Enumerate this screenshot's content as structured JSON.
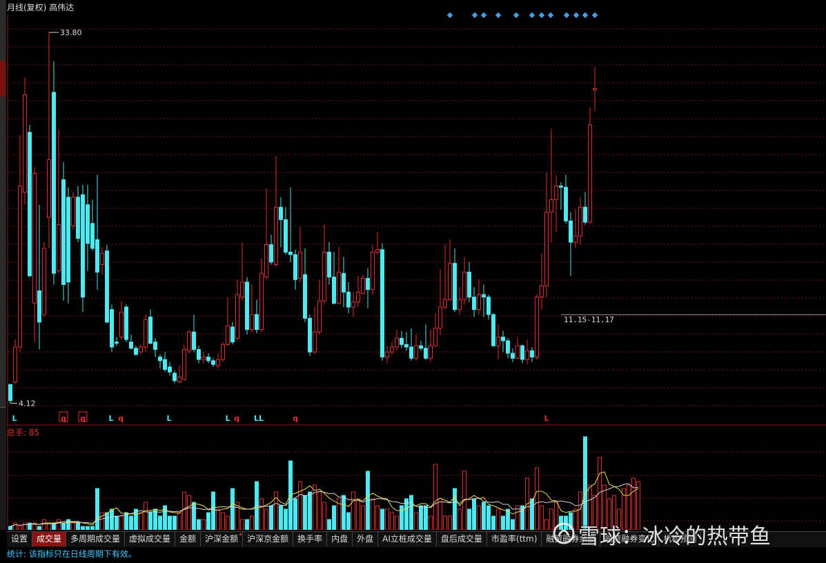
{
  "header": {
    "title": "月线(复权) 高伟达"
  },
  "volume_header": {
    "label": "总手: 85"
  },
  "colors": {
    "up": "#e03030",
    "down": "#4ee8f0",
    "ma_white": "#d8d8d8",
    "ma_yellow": "#f0e040",
    "grid": "#7a1a1a",
    "marker_blue": "#3ea0f0"
  },
  "chart_data": [
    {
      "type": "candlestick",
      "title": "月线(复权) 高伟达",
      "annotations": {
        "high": "33.80",
        "low": "4.12",
        "range_label": "11.15-11.17"
      },
      "ylim": [
        4.12,
        33.8
      ],
      "signals": [
        "L",
        "q",
        "q",
        "L",
        "q",
        "L",
        "L",
        "q",
        "LL",
        "q",
        "L"
      ],
      "candles": [
        [
          5.6,
          4.3,
          5.6,
          4.1
        ],
        [
          5.8,
          8.6,
          9.2,
          5.6
        ],
        [
          8.6,
          21.5,
          25.6,
          8.2
        ],
        [
          21.0,
          28.8,
          30.2,
          20.0
        ],
        [
          25.8,
          14.3,
          26.4,
          14.2
        ],
        [
          12.1,
          22.5,
          23.0,
          9.0
        ],
        [
          13.1,
          10.6,
          20.0,
          8.4
        ],
        [
          11.2,
          16.5,
          17.0,
          11.0
        ],
        [
          19.0,
          23.6,
          33.8,
          16.5
        ],
        [
          29.0,
          14.5,
          31.5,
          13.6
        ],
        [
          14.7,
          18.4,
          26.0,
          14.5
        ],
        [
          22.0,
          13.6,
          23.4,
          12.3
        ],
        [
          20.6,
          13.8,
          21.4,
          12.1
        ],
        [
          18.3,
          20.6,
          21.0,
          18.0
        ],
        [
          20.6,
          17.3,
          21.5,
          17.0
        ],
        [
          20.8,
          12.6,
          21.6,
          11.4
        ],
        [
          20.0,
          16.9,
          21.6,
          14.7
        ],
        [
          18.5,
          16.5,
          20.4,
          16.3
        ],
        [
          17.2,
          14.6,
          22.4,
          13.2
        ],
        [
          15.2,
          16.1,
          16.6,
          14.4
        ],
        [
          16.3,
          10.6,
          16.8,
          10.5
        ],
        [
          11.6,
          8.6,
          12.0,
          8.2
        ],
        [
          9.0,
          8.9,
          9.4,
          8.7
        ],
        [
          9.4,
          11.4,
          12.3,
          9.2
        ],
        [
          11.8,
          9.2,
          12.0,
          9.0
        ],
        [
          9.0,
          8.5,
          9.6,
          8.4
        ],
        [
          8.5,
          8.0,
          8.7,
          7.9
        ],
        [
          8.2,
          8.6,
          8.8,
          8.0
        ],
        [
          8.6,
          10.8,
          11.2,
          8.2
        ],
        [
          11.0,
          8.9,
          11.6,
          8.8
        ],
        [
          9.0,
          8.4,
          9.3,
          7.8
        ],
        [
          7.8,
          7.5,
          8.0,
          6.9
        ],
        [
          7.6,
          6.8,
          8.2,
          6.6
        ],
        [
          7.0,
          6.6,
          7.4,
          6.3
        ],
        [
          6.5,
          5.9,
          6.7,
          5.7
        ],
        [
          5.8,
          6.2,
          7.1,
          5.7
        ],
        [
          6.0,
          8.4,
          8.8,
          5.9
        ],
        [
          8.3,
          9.8,
          10.0,
          8.1
        ],
        [
          9.8,
          8.4,
          11.2,
          8.2
        ],
        [
          8.4,
          7.6,
          8.7,
          7.3
        ],
        [
          7.6,
          7.8,
          8.2,
          7.3
        ],
        [
          7.8,
          7.5,
          8.1,
          7.3
        ],
        [
          7.5,
          7.2,
          7.7,
          7.0
        ],
        [
          7.1,
          7.6,
          8.1,
          6.9
        ],
        [
          7.6,
          8.8,
          9.0,
          7.4
        ],
        [
          8.8,
          10.3,
          12.6,
          8.7
        ],
        [
          10.2,
          9.0,
          10.6,
          8.8
        ],
        [
          9.3,
          12.8,
          14.0,
          9.1
        ],
        [
          12.6,
          13.8,
          17.0,
          12.3
        ],
        [
          13.8,
          10.0,
          14.2,
          9.6
        ],
        [
          10.0,
          11.2,
          13.6,
          9.8
        ],
        [
          11.2,
          10.0,
          12.4,
          9.7
        ],
        [
          10.0,
          14.5,
          15.7,
          9.8
        ],
        [
          14.2,
          16.8,
          21.3,
          14.0
        ],
        [
          16.8,
          15.4,
          17.6,
          15.2
        ],
        [
          15.2,
          19.8,
          23.9,
          15.0
        ],
        [
          19.8,
          18.8,
          20.6,
          16.6
        ],
        [
          18.8,
          16.2,
          19.8,
          16.0
        ],
        [
          16.2,
          16.0,
          21.4,
          15.4
        ],
        [
          16.0,
          14.0,
          16.4,
          13.2
        ],
        [
          14.1,
          16.2,
          18.2,
          13.8
        ],
        [
          14.4,
          10.9,
          16.5,
          10.6
        ],
        [
          10.9,
          8.2,
          11.2,
          7.9
        ],
        [
          8.2,
          9.8,
          11.8,
          8.0
        ],
        [
          9.8,
          12.3,
          14.0,
          9.6
        ],
        [
          12.3,
          16.2,
          18.4,
          12.0
        ],
        [
          16.2,
          14.2,
          17.0,
          13.6
        ],
        [
          14.2,
          12.1,
          16.2,
          12.0
        ],
        [
          12.1,
          14.6,
          16.6,
          12.0
        ],
        [
          14.5,
          13.0,
          15.8,
          11.8
        ],
        [
          13.0,
          11.8,
          13.8,
          11.3
        ],
        [
          11.8,
          12.2,
          13.0,
          11.0
        ],
        [
          12.2,
          13.0,
          14.3,
          11.8
        ],
        [
          12.9,
          14.1,
          14.4,
          12.8
        ],
        [
          14.1,
          13.2,
          14.9,
          11.7
        ],
        [
          13.2,
          16.2,
          16.8,
          12.8
        ],
        [
          16.2,
          16.4,
          17.8,
          16.0
        ],
        [
          16.4,
          7.8,
          16.9,
          7.5
        ],
        [
          7.8,
          8.2,
          8.7,
          7.3
        ],
        [
          8.2,
          8.6,
          9.0,
          8.0
        ],
        [
          8.6,
          9.3,
          10.0,
          8.3
        ],
        [
          9.3,
          8.8,
          9.9,
          8.5
        ],
        [
          8.8,
          8.6,
          9.8,
          8.3
        ],
        [
          8.6,
          7.7,
          10.1,
          7.5
        ],
        [
          7.7,
          8.7,
          9.6,
          7.5
        ],
        [
          8.7,
          8.5,
          9.1,
          8.3
        ],
        [
          8.5,
          7.7,
          10.4,
          7.6
        ],
        [
          7.7,
          8.7,
          10.0,
          7.4
        ],
        [
          8.7,
          10.1,
          11.3,
          8.6
        ],
        [
          10.1,
          11.8,
          14.8,
          9.6
        ],
        [
          11.8,
          12.4,
          16.8,
          11.6
        ],
        [
          12.4,
          15.3,
          17.2,
          12.3
        ],
        [
          15.3,
          11.6,
          16.5,
          11.4
        ],
        [
          11.6,
          12.4,
          13.4,
          11.2
        ],
        [
          12.4,
          14.6,
          15.8,
          12.0
        ],
        [
          14.6,
          12.6,
          15.4,
          12.2
        ],
        [
          12.6,
          11.6,
          13.4,
          11.0
        ],
        [
          11.6,
          12.8,
          14.0,
          11.2
        ],
        [
          12.8,
          12.6,
          13.6,
          11.0
        ],
        [
          12.6,
          11.2,
          12.8,
          10.8
        ],
        [
          11.2,
          8.7,
          11.3,
          8.6
        ],
        [
          8.7,
          9.4,
          10.4,
          7.6
        ],
        [
          9.4,
          9.1,
          9.9,
          8.2
        ],
        [
          9.1,
          8.1,
          9.3,
          7.7
        ],
        [
          8.1,
          7.7,
          8.5,
          7.4
        ],
        [
          7.7,
          8.7,
          9.4,
          7.6
        ],
        [
          8.7,
          7.6,
          8.8,
          7.3
        ],
        [
          7.6,
          8.3,
          9.2,
          7.2
        ],
        [
          8.3,
          7.8,
          8.6,
          7.4
        ],
        [
          7.8,
          12.6,
          12.8,
          7.6
        ],
        [
          12.6,
          13.5,
          16.1,
          11.6
        ],
        [
          13.5,
          19.4,
          22.6,
          12.6
        ],
        [
          19.4,
          20.4,
          26.1,
          17.0
        ],
        [
          20.4,
          21.5,
          22.4,
          17.8
        ],
        [
          21.5,
          21.4,
          21.8,
          19.6
        ],
        [
          21.4,
          18.7,
          22.4,
          18.5
        ],
        [
          18.7,
          17.0,
          19.4,
          14.3
        ],
        [
          17.0,
          17.5,
          19.6,
          16.5
        ],
        [
          17.5,
          19.8,
          20.6,
          16.8
        ],
        [
          19.8,
          18.6,
          21.0,
          18.4
        ],
        [
          18.6,
          26.4,
          27.8,
          18.4
        ],
        [
          29.2,
          29.3,
          31.0,
          27.5
        ]
      ]
    },
    {
      "type": "bar",
      "title": "总手: 85",
      "values": [
        1,
        2,
        1,
        2,
        2,
        2,
        1,
        3,
        2,
        2,
        3,
        2,
        3,
        2,
        2,
        1,
        1,
        1,
        12,
        5,
        5,
        6,
        4,
        4,
        5,
        4,
        6,
        5,
        8,
        5,
        6,
        4,
        7,
        4,
        4,
        5,
        11,
        10,
        8,
        3,
        3,
        5,
        11,
        6,
        5,
        4,
        12,
        8,
        3,
        3,
        4,
        14,
        9,
        6,
        7,
        11,
        7,
        6,
        20,
        9,
        14,
        10,
        11,
        13,
        11,
        8,
        3,
        7,
        9,
        10,
        5,
        11,
        9,
        7,
        17,
        9,
        7,
        6,
        6,
        5,
        4,
        7,
        9,
        10,
        5,
        7,
        7,
        4,
        19,
        9,
        4,
        4,
        12,
        6,
        17,
        6,
        9,
        7,
        8,
        7,
        4,
        6,
        4,
        6,
        3,
        7,
        7,
        15,
        9,
        18,
        7,
        3,
        6,
        8,
        4,
        4,
        5,
        6,
        11,
        27,
        13,
        10,
        21,
        13,
        9,
        10,
        6,
        12,
        13,
        15,
        14
      ]
    }
  ],
  "tabs": [
    {
      "label": "设置",
      "dot": false,
      "active": false
    },
    {
      "label": "成交量",
      "dot": false,
      "active": true
    },
    {
      "label": "多周期成交量",
      "dot": false,
      "active": false
    },
    {
      "label": "虚拟成交量",
      "dot": false,
      "active": false
    },
    {
      "label": "金额",
      "dot": false,
      "active": false
    },
    {
      "label": "沪深金额",
      "dot": true,
      "active": false
    },
    {
      "label": "沪深京金额",
      "dot": false,
      "active": false
    },
    {
      "label": "换手率",
      "dot": false,
      "active": false
    },
    {
      "label": "内盘",
      "dot": false,
      "active": false
    },
    {
      "label": "外盘",
      "dot": false,
      "active": false
    },
    {
      "label": "AI立桩成交量",
      "dot": false,
      "active": false
    },
    {
      "label": "盘后成交量",
      "dot": false,
      "active": false
    },
    {
      "label": "市盈率(ttm)",
      "dot": false,
      "active": false
    },
    {
      "label": "融资融券余额",
      "dot": false,
      "active": false
    },
    {
      "label": "融资融券变化",
      "dot": false,
      "active": false
    },
    {
      "label": "机构预测",
      "dot": false,
      "active": false
    }
  ],
  "status": {
    "text": "统计: 该指标只在日线周期下有效。"
  },
  "watermark": {
    "text": "雪球：冰冷的热带鱼"
  }
}
